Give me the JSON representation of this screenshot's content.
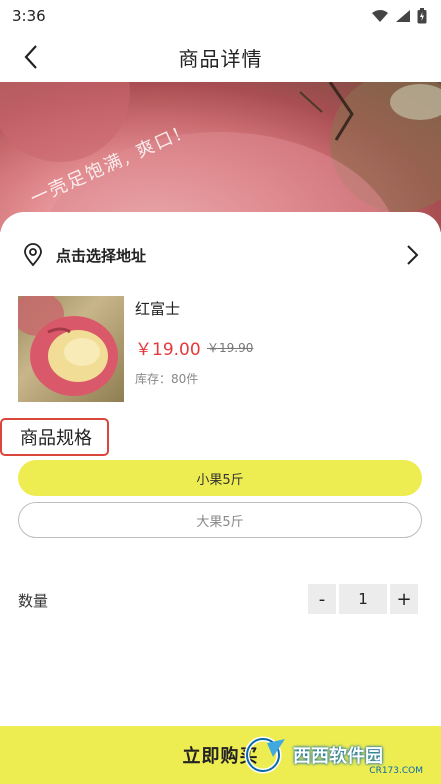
{
  "status_bar": {
    "time": "3:36"
  },
  "nav": {
    "title": "商品详情"
  },
  "hero": {
    "caption": "一壳足饱满, 爽口!"
  },
  "address": {
    "label": "点击选择地址"
  },
  "product": {
    "name": "红富士",
    "price": "￥19.00",
    "old_price": "￥19.90",
    "stock": "库存：80件"
  },
  "spec": {
    "title": "商品规格",
    "options": [
      "小果5斤",
      "大果5斤"
    ],
    "selected": "小果5斤"
  },
  "quantity": {
    "label": "数量",
    "value": "1",
    "minus": "-",
    "plus": "+"
  },
  "buy": {
    "label": "立即购买"
  },
  "watermark": {
    "brand": "西西软件园",
    "url": "CR173.COM"
  },
  "colors": {
    "accent": "#eded52",
    "price": "#e4393c",
    "highlight_border": "#d9463b"
  }
}
